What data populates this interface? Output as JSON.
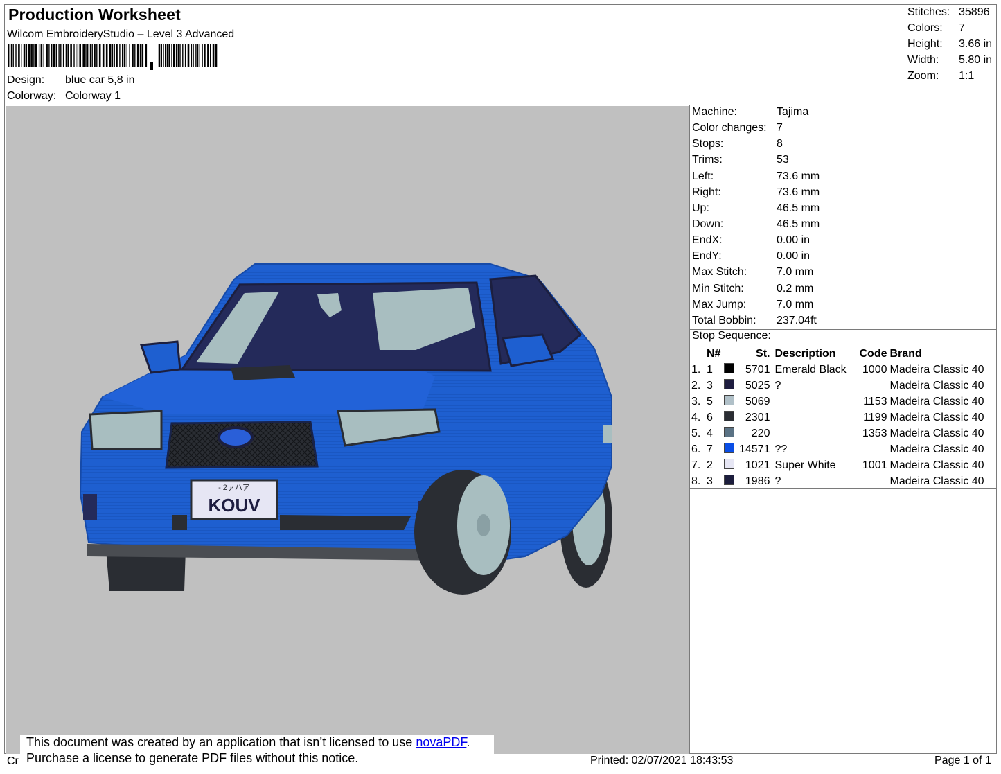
{
  "header": {
    "title": "Production Worksheet",
    "subtitle": "Wilcom EmbroideryStudio – Level 3 Advanced",
    "design_label": "Design:",
    "design_value": "blue car 5,8 in",
    "colorway_label": "Colorway:",
    "colorway_value": "Colorway 1"
  },
  "stats": [
    {
      "label": "Stitches:",
      "value": "35896"
    },
    {
      "label": "Colors:",
      "value": "7"
    },
    {
      "label": "Height:",
      "value": "3.66 in"
    },
    {
      "label": "Width:",
      "value": "5.80 in"
    },
    {
      "label": "Zoom:",
      "value": "1:1"
    }
  ],
  "machine_info": [
    {
      "label": "Machine:",
      "value": "Tajima"
    },
    {
      "label": "Color changes:",
      "value": "7"
    },
    {
      "label": "Stops:",
      "value": "8"
    },
    {
      "label": "Trims:",
      "value": "53"
    },
    {
      "label": "Left:",
      "value": "73.6 mm"
    },
    {
      "label": "Right:",
      "value": "73.6 mm"
    },
    {
      "label": "Up:",
      "value": "46.5 mm"
    },
    {
      "label": "Down:",
      "value": "46.5 mm"
    },
    {
      "label": "EndX:",
      "value": "0.00 in"
    },
    {
      "label": "EndY:",
      "value": "0.00 in"
    },
    {
      "label": "Max Stitch:",
      "value": "7.0 mm"
    },
    {
      "label": "Min Stitch:",
      "value": "0.2 mm"
    },
    {
      "label": "Max Jump:",
      "value": "7.0 mm"
    },
    {
      "label": "Total Bobbin:",
      "value": "237.04ft"
    }
  ],
  "stop_sequence": {
    "title": "Stop Sequence:",
    "headers": {
      "n": "N#",
      "st": "St.",
      "description": "Description",
      "code": "Code",
      "brand": "Brand"
    },
    "rows": [
      {
        "idx": "1.",
        "n": "1",
        "color": "#000000",
        "st": "5701",
        "description": "Emerald Black",
        "code": "1000",
        "brand": "Madeira Classic 40"
      },
      {
        "idx": "2.",
        "n": "3",
        "color": "#1e1d40",
        "st": "5025",
        "description": "?",
        "code": "",
        "brand": "Madeira Classic 40"
      },
      {
        "idx": "3.",
        "n": "5",
        "color": "#b0c0c8",
        "st": "5069",
        "description": "",
        "code": "1153",
        "brand": "Madeira Classic 40"
      },
      {
        "idx": "4.",
        "n": "6",
        "color": "#2a2d33",
        "st": "2301",
        "description": "",
        "code": "1199",
        "brand": "Madeira Classic 40"
      },
      {
        "idx": "5.",
        "n": "4",
        "color": "#5a7284",
        "st": "220",
        "description": "",
        "code": "1353",
        "brand": "Madeira Classic 40"
      },
      {
        "idx": "6.",
        "n": "7",
        "color": "#0a4ee6",
        "st": "14571",
        "description": "??",
        "code": "",
        "brand": "Madeira Classic 40"
      },
      {
        "idx": "7.",
        "n": "2",
        "color": "#e6e6f4",
        "st": "1021",
        "description": "Super White",
        "code": "1001",
        "brand": "Madeira Classic 40"
      },
      {
        "idx": "8.",
        "n": "3",
        "color": "#1c1d3c",
        "st": "1986",
        "description": "?",
        "code": "",
        "brand": "Madeira Classic 40"
      }
    ]
  },
  "design_preview": {
    "plate_text": "KOUV",
    "plate_top_text": "- 2ァハア",
    "body_color": "#1e5fd0",
    "background_color": "#c0c0c0"
  },
  "notice": {
    "line1_prefix": "This document was created by an application that isn’t licensed to use ",
    "link_text": "novaPDF",
    "line1_suffix": ".",
    "line2": "Purchase a license to generate PDF files without this notice."
  },
  "footer": {
    "left_text": "Cr",
    "printed": "Printed: 02/07/2021 18:43:53",
    "page": "Page 1 of 1"
  }
}
